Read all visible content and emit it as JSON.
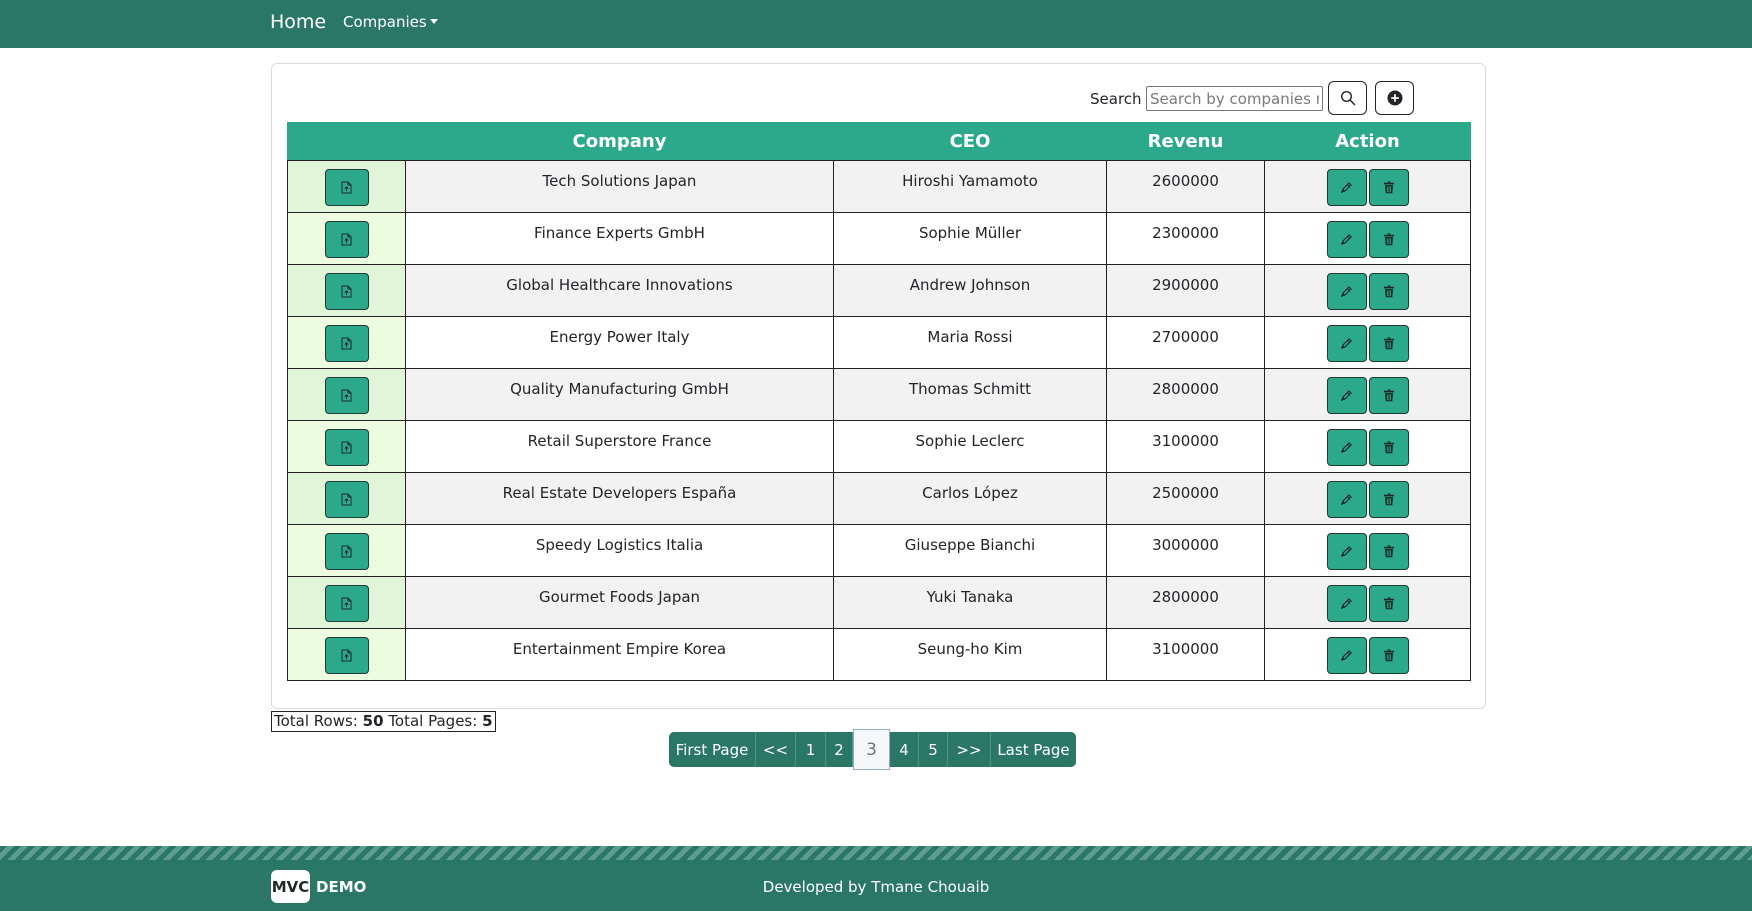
{
  "navbar": {
    "home_label": "Home",
    "companies_label": "Companies"
  },
  "search": {
    "label": "Search :",
    "placeholder": "Search by companies name"
  },
  "table": {
    "headers": [
      "",
      "Company",
      "CEO",
      "Revenu",
      "Action"
    ],
    "rows": [
      {
        "company": "Tech Solutions Japan",
        "ceo": "Hiroshi Yamamoto",
        "revenue": "2600000"
      },
      {
        "company": "Finance Experts GmbH",
        "ceo": "Sophie Müller",
        "revenue": "2300000"
      },
      {
        "company": "Global Healthcare Innovations",
        "ceo": "Andrew Johnson",
        "revenue": "2900000"
      },
      {
        "company": "Energy Power Italy",
        "ceo": "Maria Rossi",
        "revenue": "2700000"
      },
      {
        "company": "Quality Manufacturing GmbH",
        "ceo": "Thomas Schmitt",
        "revenue": "2800000"
      },
      {
        "company": "Retail Superstore France",
        "ceo": "Sophie Leclerc",
        "revenue": "3100000"
      },
      {
        "company": "Real Estate Developers España",
        "ceo": "Carlos López",
        "revenue": "2500000"
      },
      {
        "company": "Speedy Logistics Italia",
        "ceo": "Giuseppe Bianchi",
        "revenue": "3000000"
      },
      {
        "company": "Gourmet Foods Japan",
        "ceo": "Yuki Tanaka",
        "revenue": "2800000"
      },
      {
        "company": "Entertainment Empire Korea",
        "ceo": "Seung-ho Kim",
        "revenue": "3100000"
      }
    ]
  },
  "summary": {
    "rows_label": "Total Rows:",
    "rows_value": "50",
    "pages_label": "Total Pages:",
    "pages_value": "5"
  },
  "pagination": {
    "items": [
      "First Page",
      "<<",
      "1",
      "2",
      "3",
      "4",
      "5",
      ">>",
      "Last Page"
    ],
    "active": "3"
  },
  "footer": {
    "logo_mark": "MVC",
    "logo_text": "DEMO",
    "credit": "Developed by Tmane Chouaib"
  },
  "colors": {
    "brand": "#2a7766",
    "table_header": "#2ba98a",
    "button": "#2ba98a"
  },
  "icons": {
    "search": "search-icon",
    "add": "plus-circle-icon",
    "document": "file-arrow-up-icon",
    "edit": "pen-icon",
    "delete": "trash-icon"
  }
}
